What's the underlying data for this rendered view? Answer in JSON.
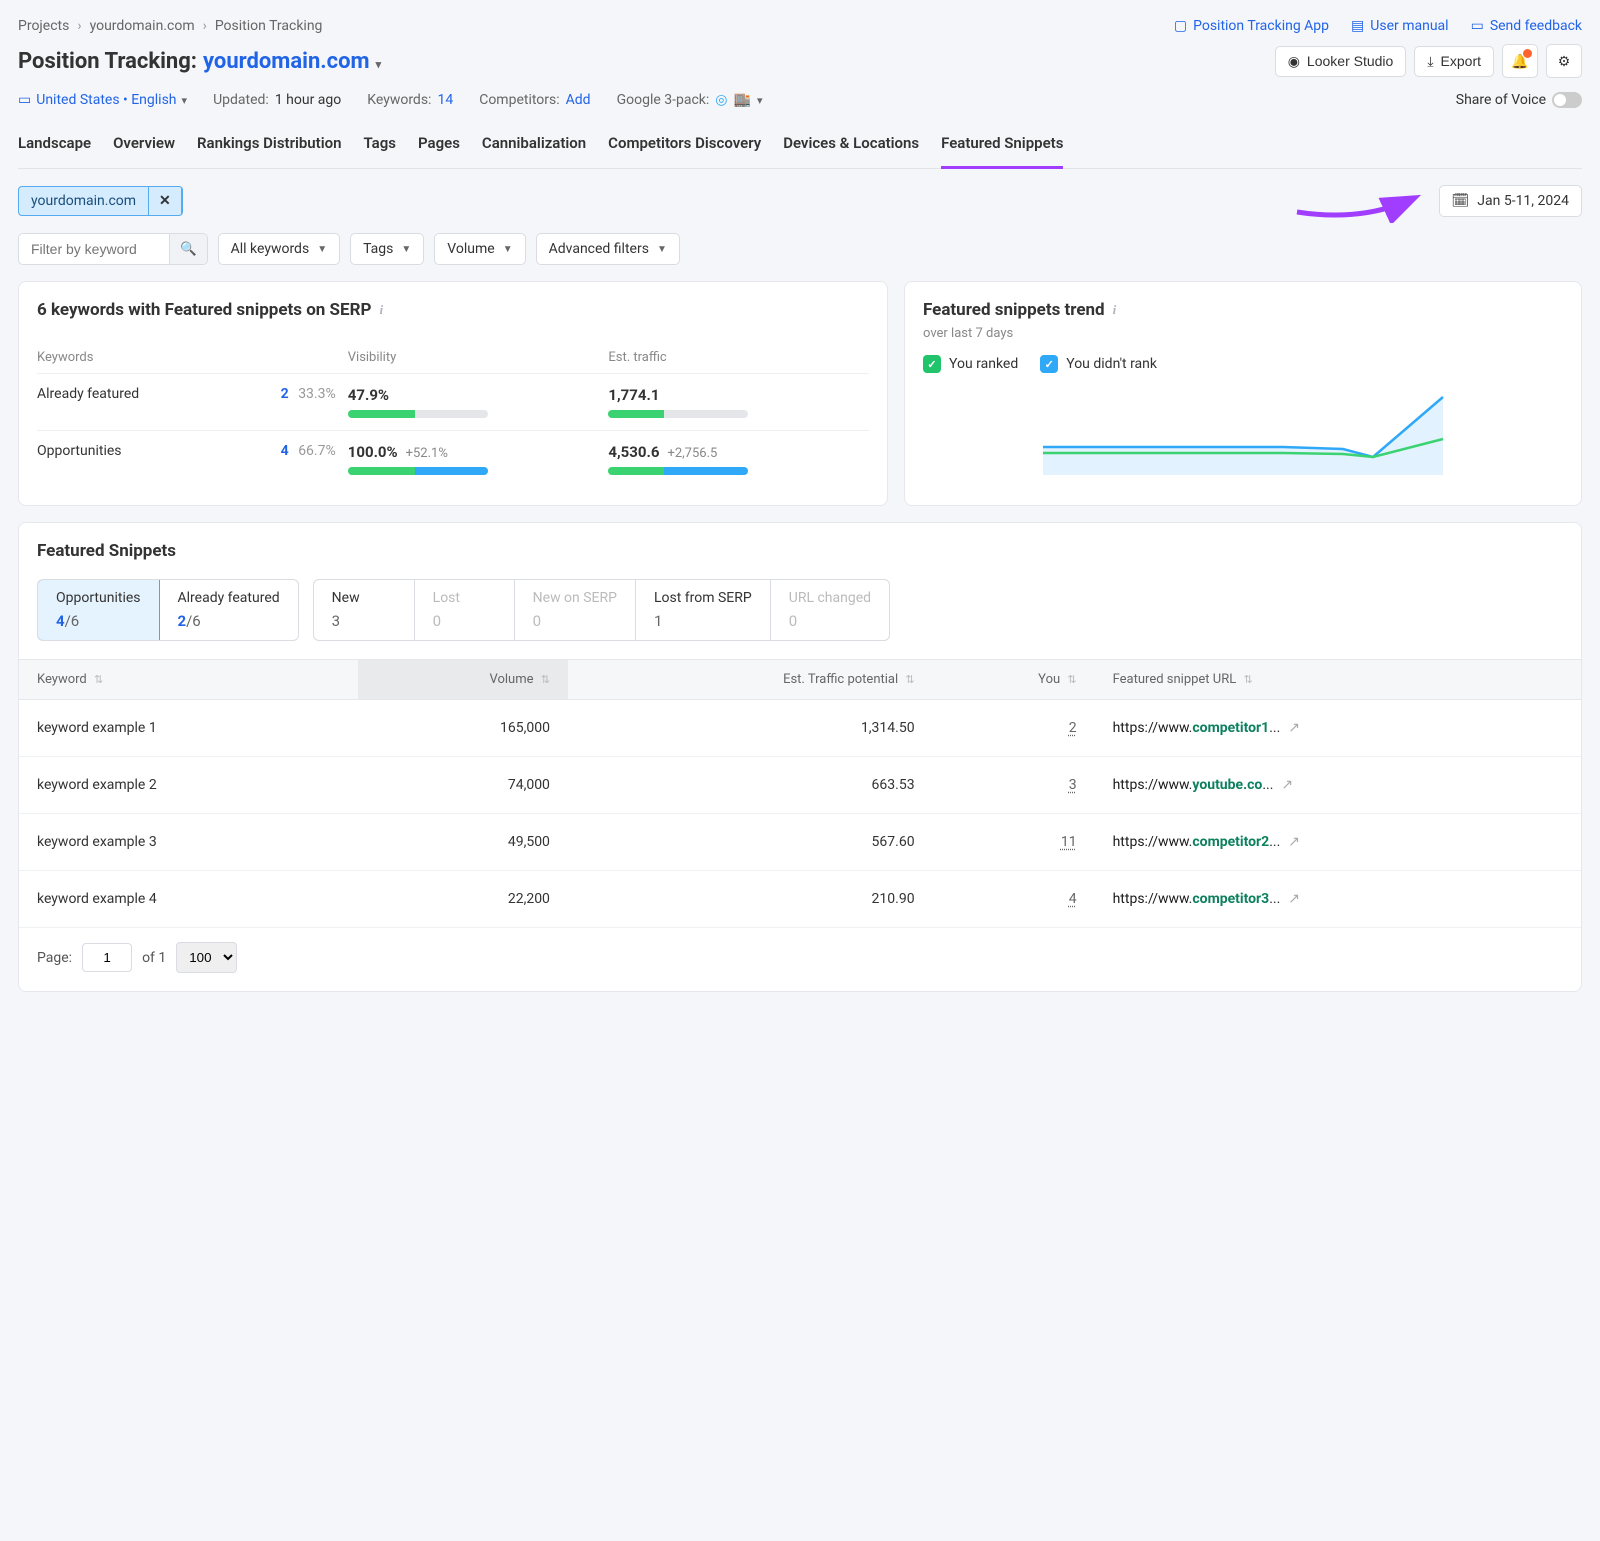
{
  "breadcrumb": [
    "Projects",
    "yourdomain.com",
    "Position Tracking"
  ],
  "top_links": {
    "app": "Position Tracking App",
    "manual": "User manual",
    "feedback": "Send feedback"
  },
  "page_title": {
    "prefix": "Position Tracking:",
    "domain": "yourdomain.com"
  },
  "actions": {
    "looker": "Looker Studio",
    "export": "Export"
  },
  "meta": {
    "locale": "United States • English",
    "updated_label": "Updated:",
    "updated_val": "1 hour ago",
    "keywords_label": "Keywords:",
    "keywords_val": "14",
    "competitors_label": "Competitors:",
    "competitors_val": "Add",
    "g3pack_label": "Google 3-pack:",
    "sov_label": "Share of Voice"
  },
  "tabs": [
    "Landscape",
    "Overview",
    "Rankings Distribution",
    "Tags",
    "Pages",
    "Cannibalization",
    "Competitors Discovery",
    "Devices & Locations",
    "Featured Snippets"
  ],
  "active_tab": "Featured Snippets",
  "domain_chip": "yourdomain.com",
  "filters": {
    "keyword_placeholder": "Filter by keyword",
    "all_keywords": "All keywords",
    "tags": "Tags",
    "volume": "Volume",
    "advanced": "Advanced filters",
    "date_range": "Jan 5-11, 2024"
  },
  "kpi_card": {
    "title": "6 keywords with Featured snippets on SERP",
    "cols": [
      "Keywords",
      "Visibility",
      "Est. traffic"
    ],
    "rows": [
      {
        "name": "Already featured",
        "count": "2",
        "pct": "33.3%",
        "vis": "47.9%",
        "vis_delta": "",
        "vis_fill": 48,
        "vis_fill_blue": 0,
        "traffic": "1,774.1",
        "traffic_delta": "",
        "tr_fill": 40,
        "tr_fill_blue": 0
      },
      {
        "name": "Opportunities",
        "count": "4",
        "pct": "66.7%",
        "vis": "100.0%",
        "vis_delta": "+52.1%",
        "vis_fill": 48,
        "vis_fill_blue": 52,
        "traffic": "4,530.6",
        "traffic_delta": "+2,756.5",
        "tr_fill": 40,
        "tr_fill_blue": 60
      }
    ]
  },
  "trend_card": {
    "title": "Featured snippets trend",
    "sub": "over last 7 days",
    "legend": {
      "ranked": "You ranked",
      "not_ranked": "You didn't rank"
    }
  },
  "snippets": {
    "title": "Featured Snippets",
    "group1": [
      {
        "label": "Opportunities",
        "n": "4",
        "d": "/6",
        "active": true,
        "disabled": false
      },
      {
        "label": "Already featured",
        "n": "2",
        "d": "/6",
        "active": false,
        "disabled": false
      }
    ],
    "group2": [
      {
        "label": "New",
        "n": "3",
        "d": "",
        "disabled": false
      },
      {
        "label": "Lost",
        "n": "0",
        "d": "",
        "disabled": true
      },
      {
        "label": "New on SERP",
        "n": "0",
        "d": "",
        "disabled": true
      },
      {
        "label": "Lost from SERP",
        "n": "1",
        "d": "",
        "disabled": false
      },
      {
        "label": "URL changed",
        "n": "0",
        "d": "",
        "disabled": true
      }
    ],
    "cols": [
      "Keyword",
      "Volume",
      "Est. Traffic potential",
      "You",
      "Featured snippet URL"
    ],
    "rows": [
      {
        "kw": "keyword example 1",
        "vol": "165,000",
        "etp": "1,314.50",
        "you": "2",
        "url_pre": "https://www.",
        "url_bold": "competitor1",
        "url_suf": "..."
      },
      {
        "kw": "keyword example 2",
        "vol": "74,000",
        "etp": "663.53",
        "you": "3",
        "url_pre": "https://www.",
        "url_bold": "youtube.co",
        "url_suf": "..."
      },
      {
        "kw": "keyword example 3",
        "vol": "49,500",
        "etp": "567.60",
        "you": "11",
        "url_pre": "https://www.",
        "url_bold": "competitor2",
        "url_suf": "..."
      },
      {
        "kw": "keyword example 4",
        "vol": "22,200",
        "etp": "210.90",
        "you": "4",
        "url_pre": "https://www.",
        "url_bold": "competitor3",
        "url_suf": "..."
      }
    ]
  },
  "pager": {
    "page_label": "Page:",
    "page": "1",
    "of": "of 1",
    "size": "100"
  }
}
